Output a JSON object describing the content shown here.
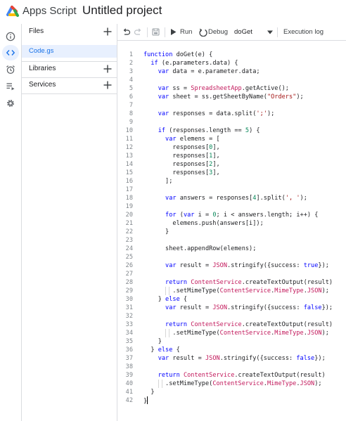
{
  "header": {
    "app_name": "Apps Script",
    "project_title": "Untitled project"
  },
  "rail": {
    "items": [
      {
        "name": "overview",
        "icon": "info-icon",
        "active": false
      },
      {
        "name": "editor",
        "icon": "code-icon",
        "active": true
      },
      {
        "name": "triggers",
        "icon": "alarm-clock-icon",
        "active": false
      },
      {
        "name": "executions",
        "icon": "list-play-icon",
        "active": false
      },
      {
        "name": "settings",
        "icon": "gear-icon",
        "active": false
      }
    ]
  },
  "panel": {
    "files_label": "Files",
    "files": [
      "Code.gs"
    ],
    "libraries_label": "Libraries",
    "services_label": "Services"
  },
  "toolbar": {
    "run_label": "Run",
    "debug_label": "Debug",
    "function_value": "doGet",
    "execution_log_label": "Execution log"
  },
  "editor": {
    "lines": [
      "function doGet(e) {",
      "  if (e.parameters.data) {",
      "    var data = e.parameter.data;",
      "",
      "    var ss = SpreadsheetApp.getActive();",
      "    var sheet = ss.getSheetByName(\"Orders\");",
      "",
      "    var responses = data.split(';');",
      "",
      "    if (responses.length == 5) {",
      "      var elemens = [",
      "        responses[0],",
      "        responses[1],",
      "        responses[2],",
      "        responses[3],",
      "      ];",
      "",
      "      var answers = responses[4].split(', ');",
      "",
      "      for (var i = 0; i < answers.length; i++) {",
      "        elemens.push(answers[i]);",
      "      }",
      "",
      "      sheet.appendRow(elemens);",
      "",
      "      var result = JSON.stringify({success: true});",
      "",
      "      return ContentService.createTextOutput(result)",
      "        .setMimeType(ContentService.MimeType.JSON);",
      "    } else {",
      "      var result = JSON.stringify({success: false});",
      "",
      "      return ContentService.createTextOutput(result)",
      "        .setMimeType(ContentService.MimeType.JSON);",
      "    }",
      "  } else {",
      "    var result = JSON.stringify({success: false});",
      "",
      "    return ContentService.createTextOutput(result)",
      "      .setMimeType(ContentService.MimeType.JSON);",
      "  }",
      "}"
    ]
  },
  "colors": {
    "accent": "#1a73e8",
    "keyword": "#0000ff",
    "string": "#a31515",
    "number": "#09885a",
    "class": "#c2185b"
  }
}
